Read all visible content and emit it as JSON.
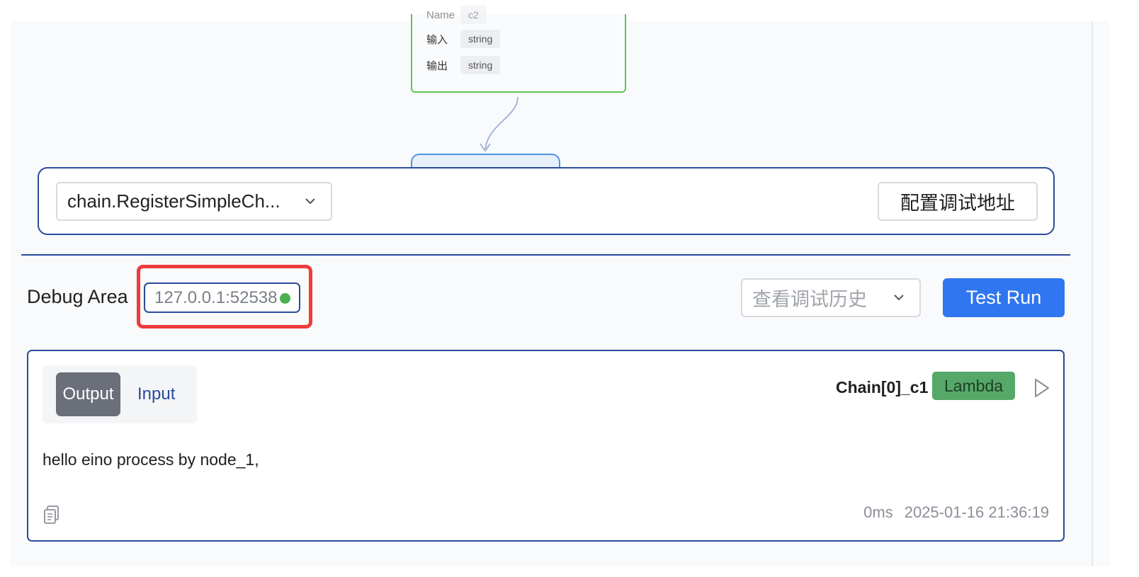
{
  "graph": {
    "node": {
      "name_label": "Name",
      "name_value": "c2",
      "input_label": "输入",
      "input_type": "string",
      "output_label": "输出",
      "output_type": "string"
    }
  },
  "toolbar": {
    "graph_select_value": "chain.RegisterSimpleCh...",
    "config_button": "配置调试地址"
  },
  "debug": {
    "title": "Debug Area",
    "address": "127.0.0.1:52538",
    "address_status_color": "#4caf50",
    "history_placeholder": "查看调试历史",
    "run_button": "Test Run"
  },
  "result": {
    "tabs": {
      "output": "Output",
      "input": "Input"
    },
    "active_tab": "Output",
    "node_label": "Chain[0]_c1",
    "node_type": "Lambda",
    "text": "hello eino process by node_1,",
    "duration": "0ms",
    "timestamp": "2025-01-16 21:36:19"
  },
  "icons": [
    "chevron-down-icon",
    "play-icon",
    "copy-icon",
    "arrow-down-icon",
    "status-dot-icon"
  ],
  "colors": {
    "primary": "#2f76f0",
    "border_accent": "#2a4b9b",
    "highlight": "#ee3b3b",
    "lambda_tag": "#55a867",
    "node_border": "#5fc45a"
  }
}
